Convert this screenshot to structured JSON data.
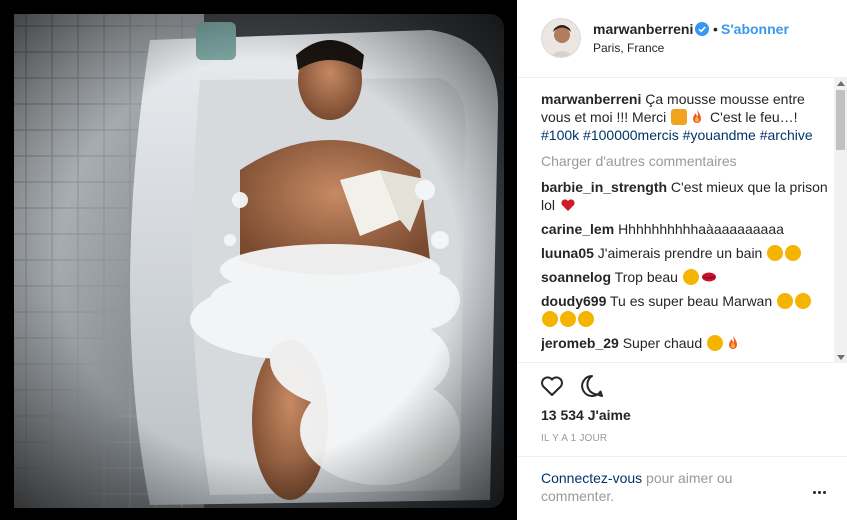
{
  "header": {
    "username": "marwanberreni",
    "separator": "•",
    "follow_label": "S'abonner",
    "location": "Paris, France"
  },
  "caption": {
    "user": "marwanberreni",
    "text_1": "Ça mousse mousse entre vous et moi !!! Merci",
    "text_2": "C'est le feu…!",
    "tags": [
      "#100k",
      "#100000mercis",
      "#youandme",
      "#archive"
    ]
  },
  "load_more_label": "Charger d'autres commentaires",
  "comments": [
    {
      "user": "barbie_in_strength",
      "text": "C'est mieux que la prison lol"
    },
    {
      "user": "carine_lem",
      "text": "Hhhhhhhhhhaàaaaaaaaaa"
    },
    {
      "user": "luuna05",
      "text": "J'aimerais prendre un bain"
    },
    {
      "user": "soannelog",
      "text": "Trop beau"
    },
    {
      "user": "doudy699",
      "text": "Tu es super beau Marwan"
    },
    {
      "user": "jeromeb_29",
      "text": "Super chaud"
    }
  ],
  "likes": "13 534 J'aime",
  "timestamp": "IL Y A 1 JOUR",
  "footer": {
    "login_link": "Connectez-vous",
    "login_text": " pour aimer ou commenter."
  },
  "icons": {
    "verified": "verified-badge-icon",
    "like": "heart-outline-icon",
    "comment": "comment-bubble-icon",
    "more": "more-options-icon"
  },
  "colors": {
    "accent": "#3897f0",
    "link": "#003569",
    "muted": "#999999"
  }
}
